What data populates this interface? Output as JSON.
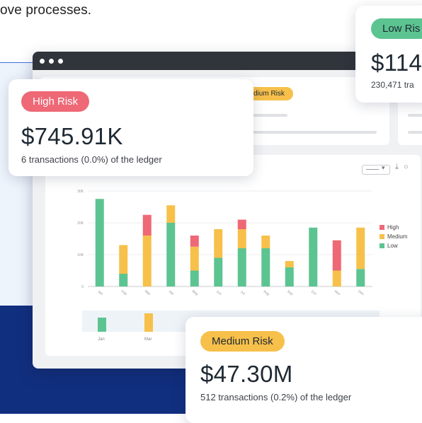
{
  "intro_text": "ove processes.",
  "cards": {
    "high": {
      "label": "High Risk",
      "amount": "$745.91K",
      "caption": "6 transactions (0.0%) of the ledger",
      "color": "#ee6876"
    },
    "medium": {
      "label": "Medium Risk",
      "amount": "$47.30M",
      "caption": "512 transactions (0.2%) of the ledger",
      "color": "#f7c04a"
    },
    "low": {
      "label": "Low Ris",
      "amount": "$114",
      "caption": "230,471 tra",
      "color": "#5cc491"
    }
  },
  "panel_pill": "dium Risk",
  "toolbar": {
    "dropdown_icon": "chevron-down-icon",
    "download_icon": "download-icon",
    "comment_icon": "comment-icon"
  },
  "colors": {
    "high": "#ee6876",
    "medium": "#f7c04a",
    "low": "#5cc491",
    "navy": "#112f7f"
  },
  "chart_data": {
    "type": "bar",
    "stacked": true,
    "categories": [
      "Jan",
      "Feb",
      "Mar",
      "Apr",
      "May",
      "Jun",
      "Jul",
      "Aug",
      "Sep",
      "Oct",
      "Nov",
      "Dec"
    ],
    "series": [
      {
        "name": "Low",
        "values": [
          27500,
          4000,
          0,
          20000,
          5000,
          9000,
          12000,
          12000,
          6000,
          18500,
          0,
          5500
        ]
      },
      {
        "name": "Medium",
        "values": [
          0,
          9000,
          16000,
          5500,
          7500,
          9000,
          6000,
          4000,
          2000,
          0,
          5000,
          13000
        ]
      },
      {
        "name": "High",
        "values": [
          0,
          0,
          6500,
          0,
          3500,
          0,
          3000,
          0,
          0,
          0,
          9500,
          0
        ]
      }
    ],
    "yticks": [
      "0",
      "10K",
      "20K",
      "30K"
    ],
    "ylim": [
      0,
      30000
    ],
    "legend_position": "right",
    "grid": true,
    "navigator": {
      "labels": [
        "Jan",
        "Mar"
      ],
      "values": [
        {
          "series": "Low",
          "value": 10000
        },
        {
          "series": "Medium",
          "value": 13000
        }
      ]
    }
  }
}
